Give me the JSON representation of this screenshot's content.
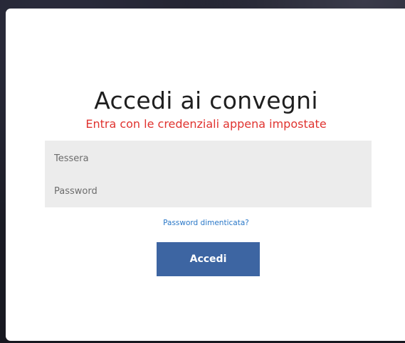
{
  "login": {
    "title": "Accedi ai convegni",
    "subtitle": "Entra con le credenziali appena impostate",
    "tessera_placeholder": "Tessera",
    "tessera_value": "",
    "password_placeholder": "Password",
    "password_value": "",
    "forgot_link": "Password dimenticata?",
    "submit_label": "Accedi"
  },
  "colors": {
    "subtitle": "#e0332f",
    "link": "#2a78c8",
    "button_bg": "#3d65a2",
    "field_bg": "#ececec"
  }
}
